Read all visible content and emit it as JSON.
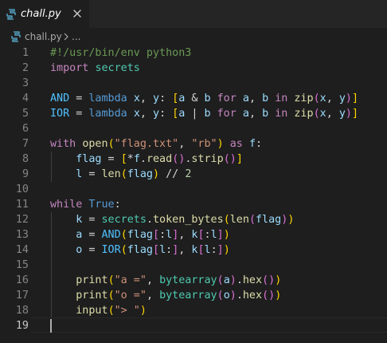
{
  "colors": {
    "background": "#1e1e1e",
    "tab_bar": "#252526",
    "python_icon": "#519aba",
    "line_number": "#858585",
    "comment": "#6a9955",
    "keyword": "#c586c0",
    "storage": "#569cd6",
    "variable": "#9cdcfe",
    "constant": "#4fc1ff",
    "function": "#dcdcaa",
    "module": "#4ec9b0",
    "string": "#ce9178",
    "number": "#b5cea8",
    "bracket_level1": "#ffd700",
    "bracket_level2": "#da70d6",
    "bracket_level3": "#179fff"
  },
  "tab": {
    "label": "chall.py",
    "file_icon": "python-file-icon",
    "close_icon": "close-icon"
  },
  "breadcrumb": {
    "file": "chall.py",
    "separator_icon": "chevron-right-icon",
    "symbol": "..."
  },
  "editor": {
    "cursor_line": 19,
    "lines": [
      {
        "n": "1",
        "tokens": [
          {
            "t": "#!/usr/bin/env python3",
            "c": "comment"
          }
        ]
      },
      {
        "n": "2",
        "tokens": [
          {
            "t": "import",
            "c": "keyword"
          },
          {
            "t": " ",
            "c": "op"
          },
          {
            "t": "secrets",
            "c": "module"
          }
        ]
      },
      {
        "n": "3",
        "tokens": []
      },
      {
        "n": "4",
        "tokens": [
          {
            "t": "AND",
            "c": "const"
          },
          {
            "t": " = ",
            "c": "op"
          },
          {
            "t": "lambda",
            "c": "storage"
          },
          {
            "t": " ",
            "c": "op"
          },
          {
            "t": "x",
            "c": "var"
          },
          {
            "t": ", ",
            "c": "op"
          },
          {
            "t": "y",
            "c": "var"
          },
          {
            "t": ": ",
            "c": "op"
          },
          {
            "t": "[",
            "c": "b1"
          },
          {
            "t": "a",
            "c": "var"
          },
          {
            "t": " & ",
            "c": "op"
          },
          {
            "t": "b",
            "c": "var"
          },
          {
            "t": " ",
            "c": "op"
          },
          {
            "t": "for",
            "c": "keyword"
          },
          {
            "t": " ",
            "c": "op"
          },
          {
            "t": "a",
            "c": "var"
          },
          {
            "t": ", ",
            "c": "op"
          },
          {
            "t": "b",
            "c": "var"
          },
          {
            "t": " ",
            "c": "op"
          },
          {
            "t": "in",
            "c": "keyword"
          },
          {
            "t": " ",
            "c": "op"
          },
          {
            "t": "zip",
            "c": "func"
          },
          {
            "t": "(",
            "c": "b2"
          },
          {
            "t": "x",
            "c": "var"
          },
          {
            "t": ", ",
            "c": "op"
          },
          {
            "t": "y",
            "c": "var"
          },
          {
            "t": ")",
            "c": "b2"
          },
          {
            "t": "]",
            "c": "b1"
          }
        ]
      },
      {
        "n": "5",
        "tokens": [
          {
            "t": "IOR",
            "c": "const"
          },
          {
            "t": " = ",
            "c": "op"
          },
          {
            "t": "lambda",
            "c": "storage"
          },
          {
            "t": " ",
            "c": "op"
          },
          {
            "t": "x",
            "c": "var"
          },
          {
            "t": ", ",
            "c": "op"
          },
          {
            "t": "y",
            "c": "var"
          },
          {
            "t": ": ",
            "c": "op"
          },
          {
            "t": "[",
            "c": "b1"
          },
          {
            "t": "a",
            "c": "var"
          },
          {
            "t": " | ",
            "c": "op"
          },
          {
            "t": "b",
            "c": "var"
          },
          {
            "t": " ",
            "c": "op"
          },
          {
            "t": "for",
            "c": "keyword"
          },
          {
            "t": " ",
            "c": "op"
          },
          {
            "t": "a",
            "c": "var"
          },
          {
            "t": ", ",
            "c": "op"
          },
          {
            "t": "b",
            "c": "var"
          },
          {
            "t": " ",
            "c": "op"
          },
          {
            "t": "in",
            "c": "keyword"
          },
          {
            "t": " ",
            "c": "op"
          },
          {
            "t": "zip",
            "c": "func"
          },
          {
            "t": "(",
            "c": "b2"
          },
          {
            "t": "x",
            "c": "var"
          },
          {
            "t": ", ",
            "c": "op"
          },
          {
            "t": "y",
            "c": "var"
          },
          {
            "t": ")",
            "c": "b2"
          },
          {
            "t": "]",
            "c": "b1"
          }
        ]
      },
      {
        "n": "6",
        "tokens": []
      },
      {
        "n": "7",
        "tokens": [
          {
            "t": "with",
            "c": "keyword"
          },
          {
            "t": " ",
            "c": "op"
          },
          {
            "t": "open",
            "c": "func"
          },
          {
            "t": "(",
            "c": "b1"
          },
          {
            "t": "\"flag.txt\"",
            "c": "string"
          },
          {
            "t": ", ",
            "c": "op"
          },
          {
            "t": "\"rb\"",
            "c": "string"
          },
          {
            "t": ")",
            "c": "b1"
          },
          {
            "t": " ",
            "c": "op"
          },
          {
            "t": "as",
            "c": "keyword"
          },
          {
            "t": " ",
            "c": "op"
          },
          {
            "t": "f",
            "c": "var"
          },
          {
            "t": ":",
            "c": "op"
          }
        ]
      },
      {
        "n": "8",
        "tokens": [
          {
            "t": "    ",
            "c": "op"
          },
          {
            "t": "flag",
            "c": "var"
          },
          {
            "t": " = ",
            "c": "op"
          },
          {
            "t": "[",
            "c": "b1"
          },
          {
            "t": "*",
            "c": "op"
          },
          {
            "t": "f",
            "c": "var"
          },
          {
            "t": ".",
            "c": "op"
          },
          {
            "t": "read",
            "c": "func"
          },
          {
            "t": "()",
            "c": "b2"
          },
          {
            "t": ".",
            "c": "op"
          },
          {
            "t": "strip",
            "c": "func"
          },
          {
            "t": "()",
            "c": "b2"
          },
          {
            "t": "]",
            "c": "b1"
          }
        ]
      },
      {
        "n": "9",
        "tokens": [
          {
            "t": "    ",
            "c": "op"
          },
          {
            "t": "l",
            "c": "var"
          },
          {
            "t": " = ",
            "c": "op"
          },
          {
            "t": "len",
            "c": "func"
          },
          {
            "t": "(",
            "c": "b1"
          },
          {
            "t": "flag",
            "c": "var"
          },
          {
            "t": ")",
            "c": "b1"
          },
          {
            "t": " // ",
            "c": "op"
          },
          {
            "t": "2",
            "c": "number"
          }
        ]
      },
      {
        "n": "10",
        "tokens": []
      },
      {
        "n": "11",
        "tokens": [
          {
            "t": "while",
            "c": "keyword"
          },
          {
            "t": " ",
            "c": "op"
          },
          {
            "t": "True",
            "c": "storage"
          },
          {
            "t": ":",
            "c": "op"
          }
        ]
      },
      {
        "n": "12",
        "tokens": [
          {
            "t": "    ",
            "c": "op"
          },
          {
            "t": "k",
            "c": "var"
          },
          {
            "t": " = ",
            "c": "op"
          },
          {
            "t": "secrets",
            "c": "module"
          },
          {
            "t": ".",
            "c": "op"
          },
          {
            "t": "token_bytes",
            "c": "func"
          },
          {
            "t": "(",
            "c": "b1"
          },
          {
            "t": "len",
            "c": "func"
          },
          {
            "t": "(",
            "c": "b2"
          },
          {
            "t": "flag",
            "c": "var"
          },
          {
            "t": ")",
            "c": "b2"
          },
          {
            "t": ")",
            "c": "b1"
          }
        ]
      },
      {
        "n": "13",
        "tokens": [
          {
            "t": "    ",
            "c": "op"
          },
          {
            "t": "a",
            "c": "var"
          },
          {
            "t": " = ",
            "c": "op"
          },
          {
            "t": "AND",
            "c": "const"
          },
          {
            "t": "(",
            "c": "b1"
          },
          {
            "t": "flag",
            "c": "var"
          },
          {
            "t": "[",
            "c": "b2"
          },
          {
            "t": ":",
            "c": "op"
          },
          {
            "t": "l",
            "c": "var"
          },
          {
            "t": "]",
            "c": "b2"
          },
          {
            "t": ", ",
            "c": "op"
          },
          {
            "t": "k",
            "c": "var"
          },
          {
            "t": "[",
            "c": "b2"
          },
          {
            "t": ":",
            "c": "op"
          },
          {
            "t": "l",
            "c": "var"
          },
          {
            "t": "]",
            "c": "b2"
          },
          {
            "t": ")",
            "c": "b1"
          }
        ]
      },
      {
        "n": "14",
        "tokens": [
          {
            "t": "    ",
            "c": "op"
          },
          {
            "t": "o",
            "c": "var"
          },
          {
            "t": " = ",
            "c": "op"
          },
          {
            "t": "IOR",
            "c": "const"
          },
          {
            "t": "(",
            "c": "b1"
          },
          {
            "t": "flag",
            "c": "var"
          },
          {
            "t": "[",
            "c": "b2"
          },
          {
            "t": "l",
            "c": "var"
          },
          {
            "t": ":",
            "c": "op"
          },
          {
            "t": "]",
            "c": "b2"
          },
          {
            "t": ", ",
            "c": "op"
          },
          {
            "t": "k",
            "c": "var"
          },
          {
            "t": "[",
            "c": "b2"
          },
          {
            "t": "l",
            "c": "var"
          },
          {
            "t": ":",
            "c": "op"
          },
          {
            "t": "]",
            "c": "b2"
          },
          {
            "t": ")",
            "c": "b1"
          }
        ]
      },
      {
        "n": "15",
        "tokens": []
      },
      {
        "n": "16",
        "tokens": [
          {
            "t": "    ",
            "c": "op"
          },
          {
            "t": "print",
            "c": "func"
          },
          {
            "t": "(",
            "c": "b1"
          },
          {
            "t": "\"a =\"",
            "c": "string"
          },
          {
            "t": ", ",
            "c": "op"
          },
          {
            "t": "bytearray",
            "c": "module"
          },
          {
            "t": "(",
            "c": "b2"
          },
          {
            "t": "a",
            "c": "var"
          },
          {
            "t": ")",
            "c": "b2"
          },
          {
            "t": ".",
            "c": "op"
          },
          {
            "t": "hex",
            "c": "func"
          },
          {
            "t": "()",
            "c": "b2"
          },
          {
            "t": ")",
            "c": "b1"
          }
        ]
      },
      {
        "n": "17",
        "tokens": [
          {
            "t": "    ",
            "c": "op"
          },
          {
            "t": "print",
            "c": "func"
          },
          {
            "t": "(",
            "c": "b1"
          },
          {
            "t": "\"o =\"",
            "c": "string"
          },
          {
            "t": ", ",
            "c": "op"
          },
          {
            "t": "bytearray",
            "c": "module"
          },
          {
            "t": "(",
            "c": "b2"
          },
          {
            "t": "o",
            "c": "var"
          },
          {
            "t": ")",
            "c": "b2"
          },
          {
            "t": ".",
            "c": "op"
          },
          {
            "t": "hex",
            "c": "func"
          },
          {
            "t": "()",
            "c": "b2"
          },
          {
            "t": ")",
            "c": "b1"
          }
        ]
      },
      {
        "n": "18",
        "tokens": [
          {
            "t": "    ",
            "c": "op"
          },
          {
            "t": "input",
            "c": "func"
          },
          {
            "t": "(",
            "c": "b1"
          },
          {
            "t": "\"> \"",
            "c": "string"
          },
          {
            "t": ")",
            "c": "b1"
          }
        ]
      },
      {
        "n": "19",
        "tokens": []
      }
    ]
  }
}
